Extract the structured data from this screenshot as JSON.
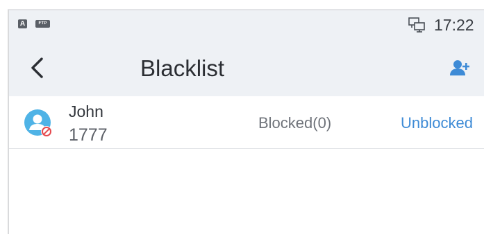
{
  "status_bar": {
    "indicator_a": "A",
    "indicator_ftp": "FTP",
    "network_icon": "network-computer-icon",
    "time": "17:22"
  },
  "header": {
    "back_icon": "chevron-left-icon",
    "title": "Blacklist",
    "add_icon": "add-contact-icon"
  },
  "blacklist": {
    "items": [
      {
        "avatar_icon": "blocked-contact-avatar-icon",
        "name": "John",
        "number": "1777",
        "blocked_label": "Blocked(0)",
        "action_label": "Unblocked"
      }
    ]
  },
  "colors": {
    "header_background": "#eef1f5",
    "accent": "#3e8bd6",
    "avatar": "#4fb3e6",
    "blocked_badge": "#e5484d"
  }
}
